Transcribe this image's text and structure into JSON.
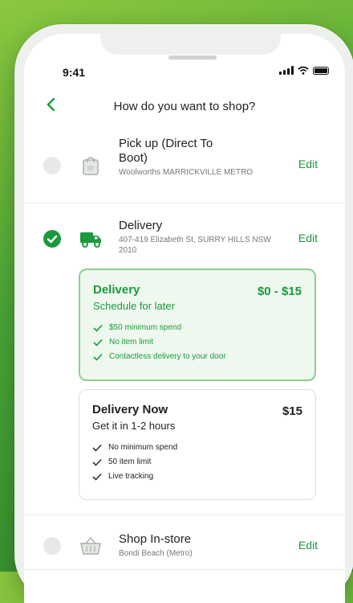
{
  "status_bar": {
    "time": "9:41"
  },
  "header": {
    "title": "How do you want to shop?"
  },
  "options": [
    {
      "title": "Pick up (Direct To Boot)",
      "subtitle": "Woolworths MARRICKVILLE METRO",
      "edit_label": "Edit",
      "selected": false,
      "icon": "bag-icon"
    },
    {
      "title": "Delivery",
      "subtitle": "407-419 Elizabeth St, SURRY HILLS NSW 2010",
      "edit_label": "Edit",
      "selected": true,
      "icon": "truck-icon"
    },
    {
      "title": "Shop In-store",
      "subtitle": "Bondi Beach (Metro)",
      "edit_label": "Edit",
      "selected": false,
      "icon": "basket-icon"
    }
  ],
  "delivery_cards": [
    {
      "title": "Delivery",
      "subtitle": "Schedule for later",
      "price": "$0 - $15",
      "selected": true,
      "features": [
        "$50 minimum spend",
        "No item limit",
        "Contactless delivery to your door"
      ]
    },
    {
      "title": "Delivery Now",
      "subtitle": "Get it in 1-2 hours",
      "price": "$15",
      "selected": false,
      "features": [
        "No minimum spend",
        "50 item limit",
        "Live tracking"
      ]
    }
  ],
  "colors": {
    "accent": "#1a9a3c",
    "selected_bg": "#eef8ee",
    "selected_border": "#8fce8f"
  }
}
